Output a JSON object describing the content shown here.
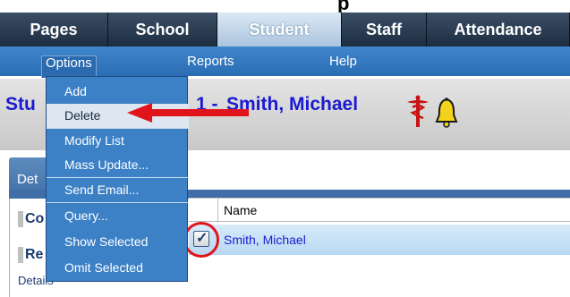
{
  "tabs": [
    {
      "label": "Pages"
    },
    {
      "label": "School"
    },
    {
      "label": "Student"
    },
    {
      "label": "Staff"
    },
    {
      "label": "Attendance"
    }
  ],
  "submenu": {
    "options": "Options",
    "reports": "Reports",
    "help": "Help"
  },
  "dropdown": [
    {
      "label": "Add"
    },
    {
      "label": "Delete"
    },
    {
      "label": "Modify List"
    },
    {
      "label": "Mass Update..."
    },
    {
      "label": "Send Email..."
    },
    {
      "label": "Query..."
    },
    {
      "label": "Show Selected"
    },
    {
      "label": "Omit Selected"
    }
  ],
  "title": {
    "prefix": "Stu",
    "number_fragment": "1 - ",
    "student_name": "Smith, Michael"
  },
  "lower": {
    "tab_fragment": "Det",
    "side_head_1": "Co",
    "side_head_2": "Re",
    "side_sub": "Details"
  },
  "table": {
    "column_name": "Name",
    "row_name": "Smith, Michael",
    "row_selected": true
  },
  "colors": {
    "title_blue": "#1a1ad0",
    "highlight_red": "#e0141a",
    "tab_active": "#b9cfe4",
    "menu_blue": "#3c80c6"
  }
}
